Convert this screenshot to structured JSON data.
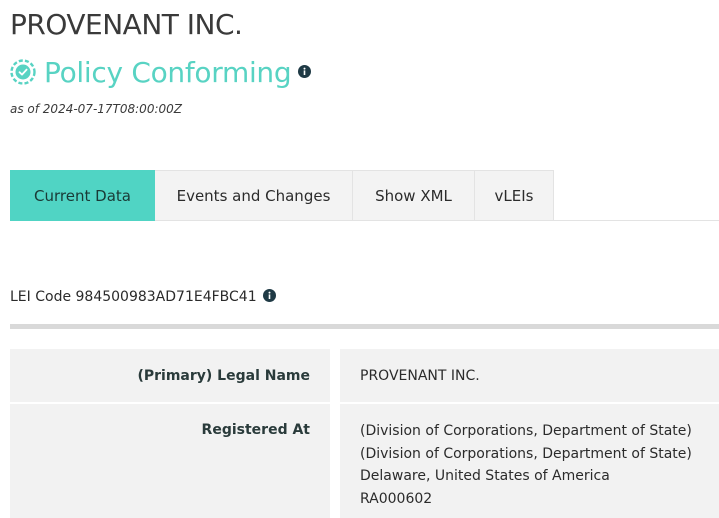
{
  "entity": {
    "name": "PROVENANT INC.",
    "status": "Policy Conforming",
    "as_of": "as of 2024-07-17T08:00:00Z"
  },
  "tabs": [
    {
      "label": "Current Data",
      "active": true
    },
    {
      "label": "Events and Changes",
      "active": false
    },
    {
      "label": "Show XML",
      "active": false
    },
    {
      "label": "vLEIs",
      "active": false
    }
  ],
  "lei": {
    "label": "LEI Code 984500983AD71E4FBC41"
  },
  "details": {
    "legal_name_label": "(Primary) Legal Name",
    "legal_name_value": "PROVENANT INC.",
    "registered_at_label": "Registered At",
    "registered_at_lines": [
      "(Division of Corporations, Department of State)",
      "(Division of Corporations, Department of State)",
      "Delaware, United States of America",
      "RA000602"
    ]
  },
  "colors": {
    "accent": "#50d4c4",
    "status_text": "#58d3c3",
    "info_icon": "#1f3a45"
  },
  "icons": {
    "status": "check-circle-icon",
    "info": "info-icon"
  }
}
